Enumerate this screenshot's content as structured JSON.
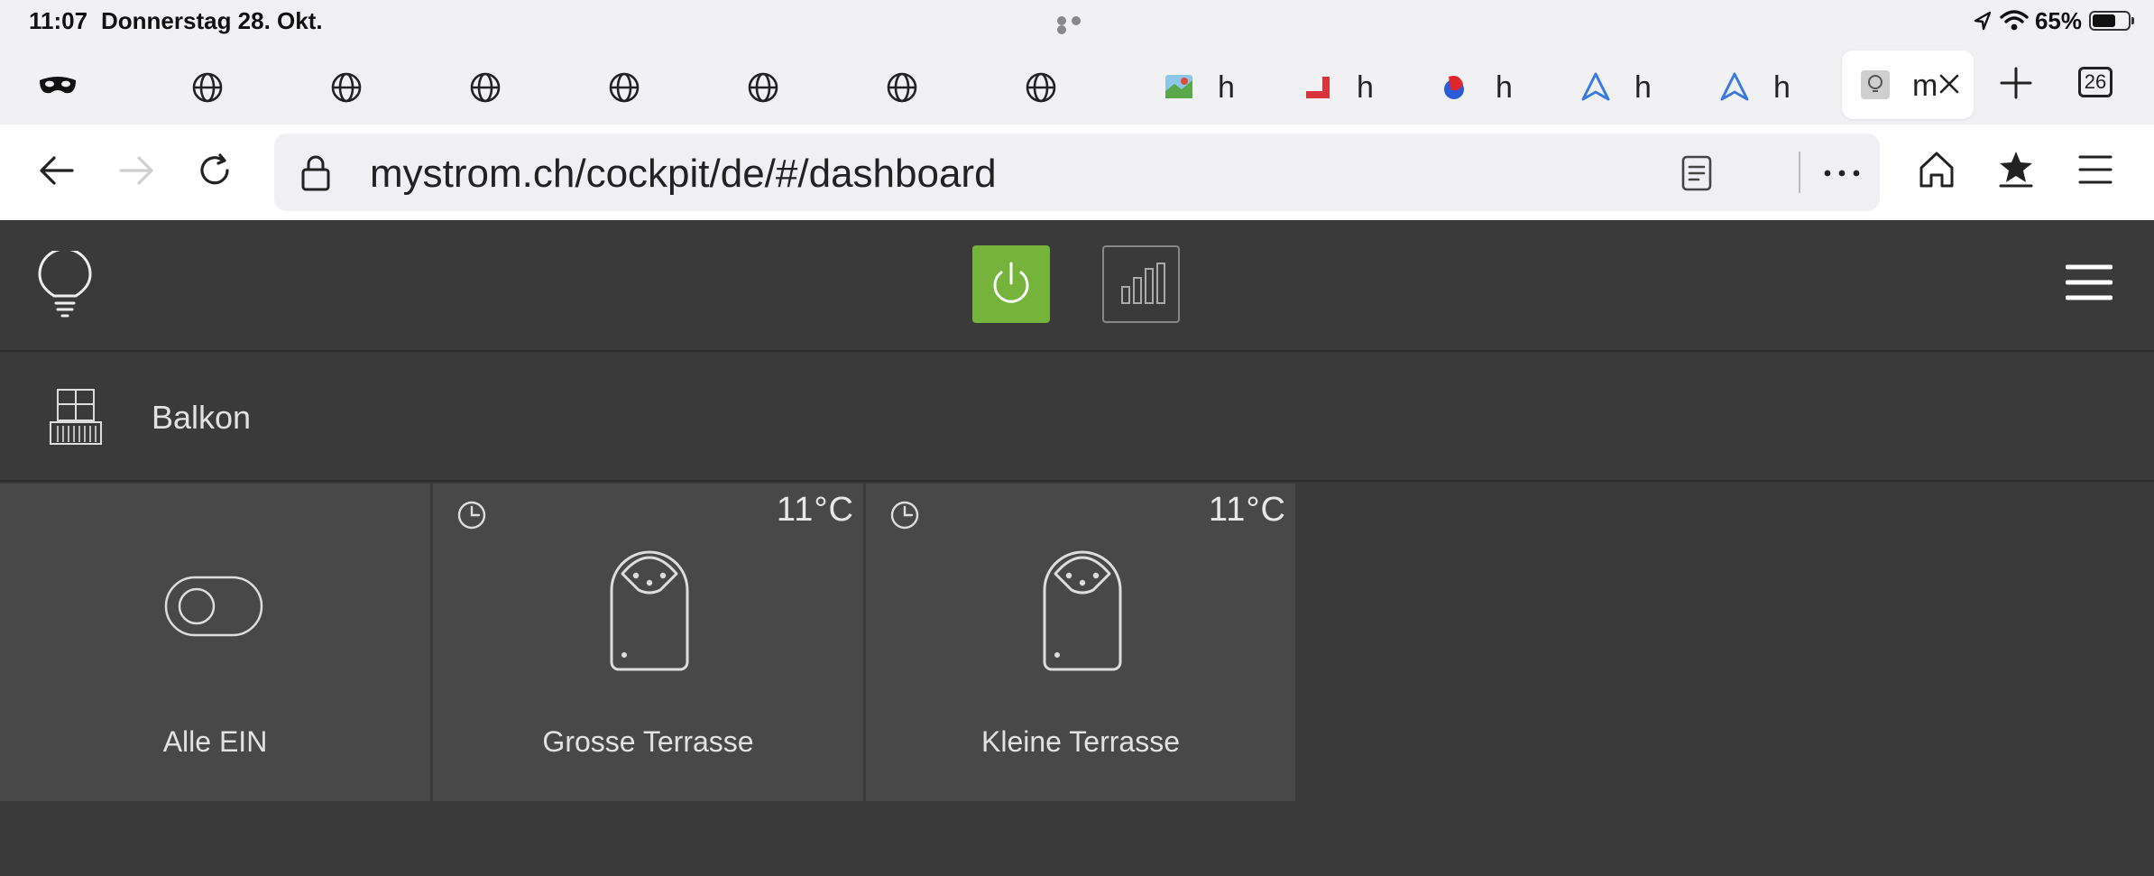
{
  "status_bar": {
    "time": "11:07",
    "date": "Donnerstag 28. Okt.",
    "battery_percent": "65%",
    "battery_level": 0.65
  },
  "tabs": {
    "items": [
      {
        "icon": "private-mask-icon",
        "label": ""
      },
      {
        "icon": "globe-icon",
        "label": ""
      },
      {
        "icon": "globe-icon",
        "label": ""
      },
      {
        "icon": "globe-icon",
        "label": ""
      },
      {
        "icon": "globe-icon",
        "label": ""
      },
      {
        "icon": "globe-icon",
        "label": ""
      },
      {
        "icon": "globe-icon",
        "label": ""
      },
      {
        "icon": "globe-icon",
        "label": ""
      },
      {
        "icon": "map-favicon-icon",
        "label": "h"
      },
      {
        "icon": "red-favicon-icon",
        "label": "h"
      },
      {
        "icon": "swiss-favicon-icon",
        "label": "h"
      },
      {
        "icon": "navigation-arrow-icon",
        "label": "h"
      },
      {
        "icon": "navigation-arrow-icon",
        "label": "h"
      }
    ],
    "active": {
      "icon": "bulb-favicon-icon",
      "label": "m"
    },
    "count": "26"
  },
  "address_bar": {
    "url": "mystrom.ch/cockpit/de/#/dashboard"
  },
  "app": {
    "room": {
      "name": "Balkon",
      "icon": "balcony-icon"
    },
    "devices": [
      {
        "name": "Alle EIN",
        "type": "toggle",
        "temperature": ""
      },
      {
        "name": "Grosse Terrasse",
        "type": "smart-plug",
        "temperature": "11°C"
      },
      {
        "name": "Kleine Terrasse",
        "type": "smart-plug",
        "temperature": "11°C"
      }
    ]
  },
  "colors": {
    "accent_green": "#76b33a",
    "app_background": "#3a3a3a",
    "tile_background": "#484848"
  }
}
